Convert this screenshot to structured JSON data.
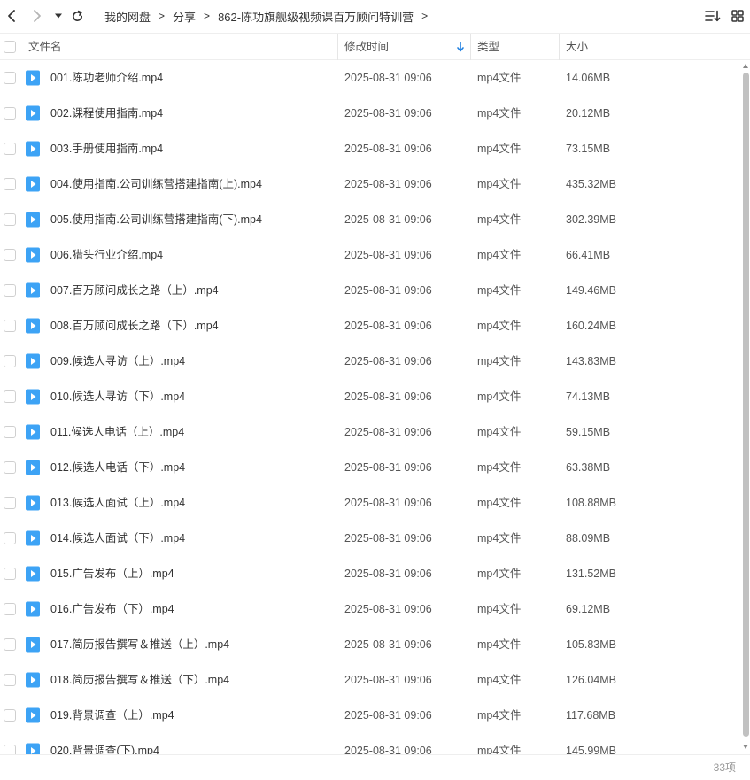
{
  "nav": {
    "breadcrumbs": [
      "我的网盘",
      "分享",
      "862-陈功旗舰级视频课百万顾问特训营"
    ]
  },
  "columns": {
    "name": "文件名",
    "modified": "修改时间",
    "type": "类型",
    "size": "大小"
  },
  "colors": {
    "file_icon": "#3da3f5",
    "sort_arrow": "#1e7fe0"
  },
  "files": [
    {
      "name": "001.陈功老师介绍.mp4",
      "modified": "2025-08-31 09:06",
      "type": "mp4文件",
      "size": "14.06MB"
    },
    {
      "name": "002.课程使用指南.mp4",
      "modified": "2025-08-31 09:06",
      "type": "mp4文件",
      "size": "20.12MB"
    },
    {
      "name": "003.手册使用指南.mp4",
      "modified": "2025-08-31 09:06",
      "type": "mp4文件",
      "size": "73.15MB"
    },
    {
      "name": "004.使用指南.公司训练营搭建指南(上).mp4",
      "modified": "2025-08-31 09:06",
      "type": "mp4文件",
      "size": "435.32MB"
    },
    {
      "name": "005.使用指南.公司训练营搭建指南(下).mp4",
      "modified": "2025-08-31 09:06",
      "type": "mp4文件",
      "size": "302.39MB"
    },
    {
      "name": "006.猎头行业介绍.mp4",
      "modified": "2025-08-31 09:06",
      "type": "mp4文件",
      "size": "66.41MB"
    },
    {
      "name": "007.百万顾问成长之路（上）.mp4",
      "modified": "2025-08-31 09:06",
      "type": "mp4文件",
      "size": "149.46MB"
    },
    {
      "name": "008.百万顾问成长之路（下）.mp4",
      "modified": "2025-08-31 09:06",
      "type": "mp4文件",
      "size": "160.24MB"
    },
    {
      "name": "009.候选人寻访（上）.mp4",
      "modified": "2025-08-31 09:06",
      "type": "mp4文件",
      "size": "143.83MB"
    },
    {
      "name": "010.候选人寻访（下）.mp4",
      "modified": "2025-08-31 09:06",
      "type": "mp4文件",
      "size": "74.13MB"
    },
    {
      "name": "011.候选人电话（上）.mp4",
      "modified": "2025-08-31 09:06",
      "type": "mp4文件",
      "size": "59.15MB"
    },
    {
      "name": "012.候选人电话（下）.mp4",
      "modified": "2025-08-31 09:06",
      "type": "mp4文件",
      "size": "63.38MB"
    },
    {
      "name": "013.候选人面试（上）.mp4",
      "modified": "2025-08-31 09:06",
      "type": "mp4文件",
      "size": "108.88MB"
    },
    {
      "name": "014.候选人面试（下）.mp4",
      "modified": "2025-08-31 09:06",
      "type": "mp4文件",
      "size": "88.09MB"
    },
    {
      "name": "015.广告发布（上）.mp4",
      "modified": "2025-08-31 09:06",
      "type": "mp4文件",
      "size": "131.52MB"
    },
    {
      "name": "016.广告发布（下）.mp4",
      "modified": "2025-08-31 09:06",
      "type": "mp4文件",
      "size": "69.12MB"
    },
    {
      "name": "017.简历报告撰写＆推送（上）.mp4",
      "modified": "2025-08-31 09:06",
      "type": "mp4文件",
      "size": "105.83MB"
    },
    {
      "name": "018.简历报告撰写＆推送（下）.mp4",
      "modified": "2025-08-31 09:06",
      "type": "mp4文件",
      "size": "126.04MB"
    },
    {
      "name": "019.背景调查（上）.mp4",
      "modified": "2025-08-31 09:06",
      "type": "mp4文件",
      "size": "117.68MB"
    },
    {
      "name": "020.背景调查(下).mp4",
      "modified": "2025-08-31 09:06",
      "type": "mp4文件",
      "size": "145.99MB"
    }
  ],
  "footer": {
    "item_count": "33项"
  }
}
